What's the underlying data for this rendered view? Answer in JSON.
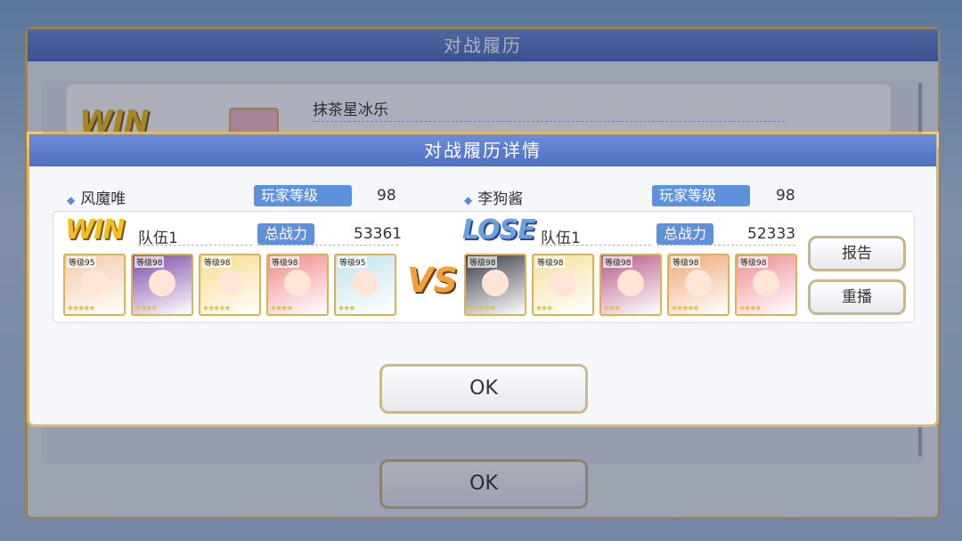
{
  "back": {
    "title": "对战履历",
    "result": "WIN",
    "opponent_name": "抹茶星冰乐",
    "ok_label": "OK"
  },
  "dialog": {
    "title": "对战履历详情",
    "vs_label": "VS",
    "report_label": "报告",
    "replay_label": "重播",
    "ok_label": "OK",
    "left": {
      "player_name": "风魔唯",
      "level_tag": "玩家等级",
      "level": "98",
      "result": "WIN",
      "team_label": "队伍1",
      "power_tag": "总战力",
      "power": "53361",
      "units": [
        {
          "level_label": "等级95",
          "stars": "★★★★★",
          "color": "#f3c9a8"
        },
        {
          "level_label": "等级98",
          "stars": "★★★★",
          "color": "#7a4aa8"
        },
        {
          "level_label": "等级98",
          "stars": "★★★★★",
          "color": "#f5dc8a"
        },
        {
          "level_label": "等级98",
          "stars": "★★★★",
          "color": "#f08a8a"
        },
        {
          "level_label": "等级95",
          "stars": "★★★",
          "color": "#bfe3f2"
        }
      ]
    },
    "right": {
      "player_name": "李狗酱",
      "level_tag": "玩家等级",
      "level": "98",
      "result": "LOSE",
      "team_label": "队伍1",
      "power_tag": "总战力",
      "power": "52333",
      "units": [
        {
          "level_label": "等级98",
          "stars": "★★★★★",
          "color": "#3a3a4a"
        },
        {
          "level_label": "等级98",
          "stars": "★★★",
          "color": "#f3e1a0"
        },
        {
          "level_label": "等级98",
          "stars": "★★★",
          "color": "#b85a8a"
        },
        {
          "level_label": "等级98",
          "stars": "★★★★★",
          "color": "#f0a878"
        },
        {
          "level_label": "等级98",
          "stars": "★★★★",
          "color": "#f08c98"
        }
      ]
    }
  }
}
